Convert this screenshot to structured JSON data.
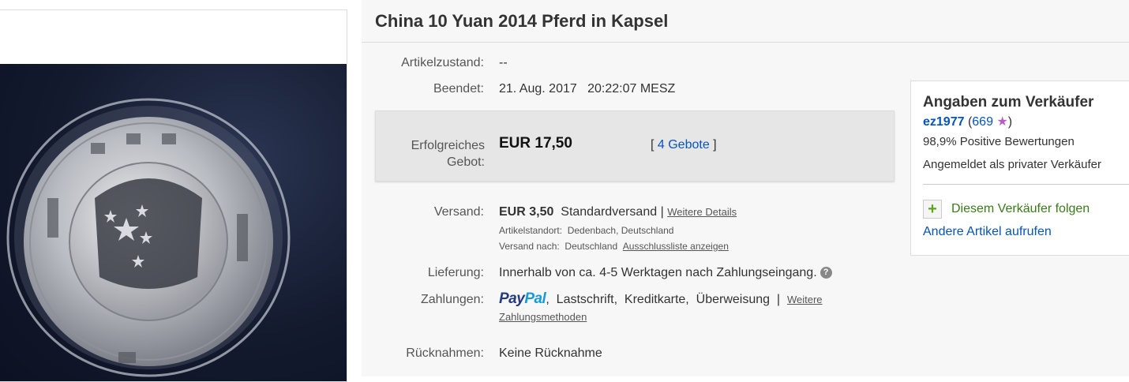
{
  "listing": {
    "title": "China 10 Yuan 2014 Pferd in Kapsel"
  },
  "details": {
    "condition_label": "Artikelzustand:",
    "condition_value": "--",
    "ended_label": "Beendet:",
    "ended_value": "21. Aug. 2017   20:22:07 MESZ"
  },
  "bid": {
    "label_line1": "Erfolgreiches",
    "label_line2": "Gebot:",
    "price": "EUR 17,50",
    "open": "[ ",
    "count_link": "4 Gebote",
    "close": " ]"
  },
  "shipping": {
    "label": "Versand:",
    "price": "EUR 3,50",
    "service": "Standardversand |",
    "details_link": "Weitere Details",
    "location_label": "Artikelstandort:",
    "location_value": "Dedenbach, Deutschland",
    "ships_to_label": "Versand nach:",
    "ships_to_value": "Deutschland",
    "exclusions_link": "Ausschlussliste anzeigen"
  },
  "delivery": {
    "label": "Lieferung:",
    "value": "Innerhalb von ca. 4-5 Werktagen nach Zahlungseingang.",
    "help_icon": "question-icon",
    "help_glyph": "?"
  },
  "payments": {
    "label": "Zahlungen:",
    "paypal_1": "Pay",
    "paypal_2": "Pal",
    "methods": ",  Lastschrift,  Kreditkarte,  Überweisung  |",
    "more_link_1": "Weitere",
    "more_link_2": "Zahlungsmethoden"
  },
  "returns": {
    "label": "Rücknahmen:",
    "value": "Keine Rücknahme"
  },
  "seller": {
    "heading": "Angaben zum Verkäufer",
    "name": "ez1977",
    "open_paren": " (",
    "feedback_count": "669",
    "star": "★",
    "close_paren": ")",
    "positive": "98,9% Positive Bewertungen",
    "account_type": "Angemeldet als privater Verkäufer",
    "follow_icon": "plus-icon",
    "follow_glyph": "+",
    "follow": "Diesem Verkäufer folgen",
    "other_items": "Andere Artikel aufrufen"
  },
  "colors": {
    "link_blue": "#0654ba",
    "follow_green": "#3a7a1a",
    "star_purple": "#b85cc7",
    "paypal_dark": "#253b80",
    "paypal_light": "#179bd7"
  }
}
